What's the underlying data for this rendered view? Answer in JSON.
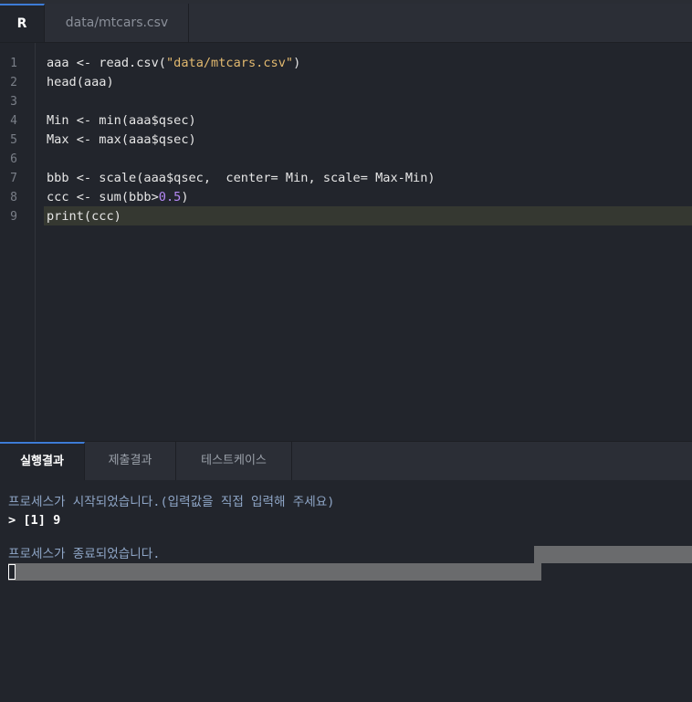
{
  "tabs": {
    "language": "R",
    "file": "data/mtcars.csv"
  },
  "editor": {
    "line_numbers": [
      "1",
      "2",
      "3",
      "4",
      "5",
      "6",
      "7",
      "8",
      "9"
    ],
    "lines": [
      {
        "pre": "aaa <- read.csv(",
        "str": "\"data/mtcars.csv\"",
        "post": ")"
      },
      {
        "pre": "head(aaa)",
        "str": "",
        "post": ""
      },
      {
        "pre": "",
        "str": "",
        "post": ""
      },
      {
        "pre": "Min <- min(aaa$qsec)",
        "str": "",
        "post": ""
      },
      {
        "pre": "Max <- max(aaa$qsec)",
        "str": "",
        "post": ""
      },
      {
        "pre": "",
        "str": "",
        "post": ""
      },
      {
        "pre": "bbb <- scale(aaa$qsec,  center= Min, scale= Max-Min)",
        "str": "",
        "post": ""
      },
      {
        "pre": "ccc <- sum(bbb>",
        "num": "0.5",
        "post": ")"
      },
      {
        "pre": "print(ccc)",
        "str": "",
        "post": ""
      }
    ],
    "active_line": 9
  },
  "panel_tabs": {
    "run_result": "실행결과",
    "submit_result": "제출결과",
    "test_case": "테스트케이스"
  },
  "console": {
    "start_msg": "프로세스가 시작되었습니다.(입력값을 직접 입력해 주세요)",
    "output": "> [1] 9",
    "end_msg": "프로세스가 종료되었습니다."
  },
  "colors": {
    "background": "#22252c",
    "tab_accent": "#3d7bd6",
    "string": "#e2b96f",
    "number": "#b589f5",
    "system_text": "#8fa6c7"
  }
}
